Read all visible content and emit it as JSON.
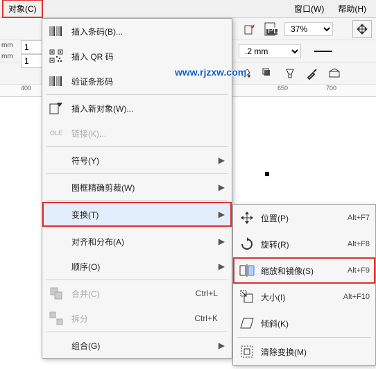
{
  "menubar": {
    "object": "对象(C)",
    "window": "窗口(W)",
    "help": "帮助(H)"
  },
  "toolbar": {
    "pdf_label": "PDF",
    "zoom_value": "37%",
    "thickness_value": ".2 mm"
  },
  "ruler": {
    "t1": "400",
    "t2": "650",
    "t3": "700"
  },
  "spinners": {
    "unit": "mm",
    "v1": "1",
    "v2": "1"
  },
  "dropdown": {
    "insert_barcode": "插入条码(B)...",
    "insert_qr": "插入 QR 码",
    "verify_barcode": "验证条形码",
    "insert_object": "插入新对象(W)...",
    "links": "链接(K)...",
    "symbol": "符号(Y)",
    "powerclip": "图框精确剪裁(W)",
    "transform": "变换(T)",
    "align": "对齐和分布(A)",
    "order": "顺序(O)",
    "combine": "合并(C)",
    "combine_sc": "Ctrl+L",
    "breakapart": "拆分",
    "breakapart_sc": "Ctrl+K",
    "group": "组合(G)"
  },
  "submenu": {
    "position": "位置(P)",
    "position_sc": "Alt+F7",
    "rotate": "旋转(R)",
    "rotate_sc": "Alt+F8",
    "scale": "缩放和镜像(S)",
    "scale_sc": "Alt+F9",
    "size": "大小(I)",
    "size_sc": "Alt+F10",
    "skew": "倾斜(K)",
    "clear": "清除变换(M)"
  },
  "watermark": "www.rjzxw.com"
}
